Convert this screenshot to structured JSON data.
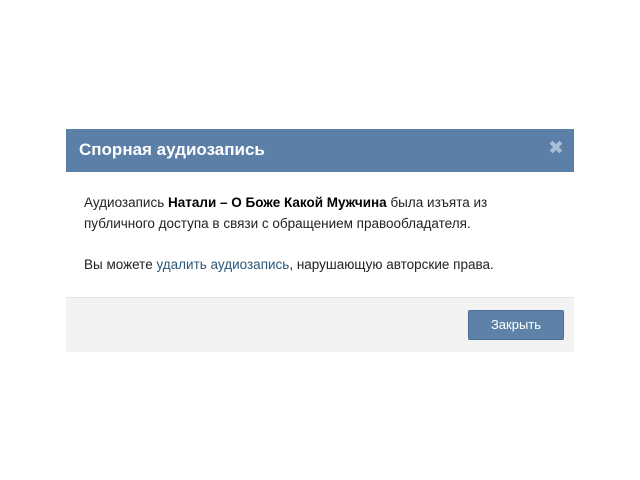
{
  "dialog": {
    "title": "Спорная аудиозапись",
    "close_icon": "✖",
    "message1": {
      "prefix": "Аудиозапись ",
      "track": "Натали – О Боже Какой Мужчина",
      "suffix": " была изъята из публичного доступа в связи с обращением правообладателя."
    },
    "message2": {
      "prefix": "Вы можете ",
      "link": "удалить аудиозапись",
      "suffix": ", нарушающую авторские права."
    },
    "close_button": "Закрыть"
  },
  "icons": {
    "close": "close-icon"
  },
  "colors": {
    "header_bg": "#5b7fa6",
    "button_bg": "#5e81a8",
    "link": "#2b587a",
    "footer_bg": "#f2f2f2"
  }
}
